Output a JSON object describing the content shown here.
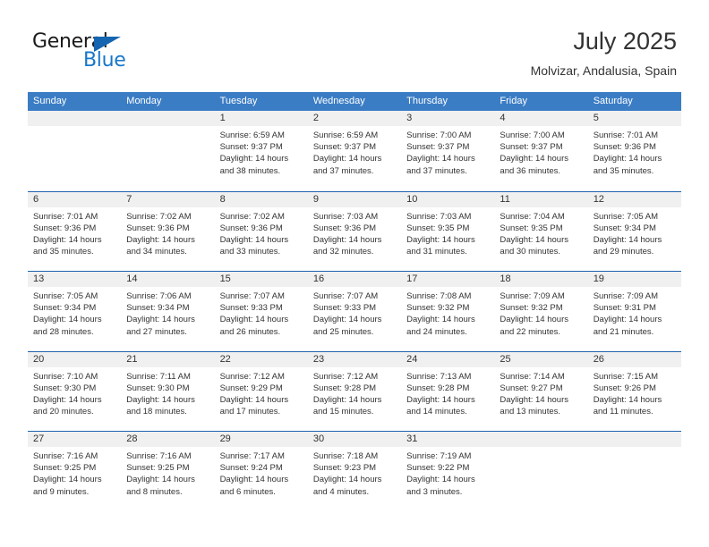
{
  "brand": {
    "name_part1": "General",
    "name_part2": "Blue",
    "triangle_icon": "triangle-icon",
    "primary_color": "#1877c9",
    "triangle_color": "#1565b0"
  },
  "header": {
    "title": "July 2025",
    "subtitle": "Molvizar, Andalusia, Spain"
  },
  "calendar": {
    "header_bg": "#3b7dc4",
    "row_divider_color": "#1f63ad",
    "day_band_bg": "#f0f0f0",
    "weekdays": [
      "Sunday",
      "Monday",
      "Tuesday",
      "Wednesday",
      "Thursday",
      "Friday",
      "Saturday"
    ],
    "weeks": [
      [
        {
          "day": "",
          "sunrise": "",
          "sunset": "",
          "daylight_line1": "",
          "daylight_line2": ""
        },
        {
          "day": "",
          "sunrise": "",
          "sunset": "",
          "daylight_line1": "",
          "daylight_line2": ""
        },
        {
          "day": "1",
          "sunrise": "Sunrise: 6:59 AM",
          "sunset": "Sunset: 9:37 PM",
          "daylight_line1": "Daylight: 14 hours",
          "daylight_line2": "and 38 minutes."
        },
        {
          "day": "2",
          "sunrise": "Sunrise: 6:59 AM",
          "sunset": "Sunset: 9:37 PM",
          "daylight_line1": "Daylight: 14 hours",
          "daylight_line2": "and 37 minutes."
        },
        {
          "day": "3",
          "sunrise": "Sunrise: 7:00 AM",
          "sunset": "Sunset: 9:37 PM",
          "daylight_line1": "Daylight: 14 hours",
          "daylight_line2": "and 37 minutes."
        },
        {
          "day": "4",
          "sunrise": "Sunrise: 7:00 AM",
          "sunset": "Sunset: 9:37 PM",
          "daylight_line1": "Daylight: 14 hours",
          "daylight_line2": "and 36 minutes."
        },
        {
          "day": "5",
          "sunrise": "Sunrise: 7:01 AM",
          "sunset": "Sunset: 9:36 PM",
          "daylight_line1": "Daylight: 14 hours",
          "daylight_line2": "and 35 minutes."
        }
      ],
      [
        {
          "day": "6",
          "sunrise": "Sunrise: 7:01 AM",
          "sunset": "Sunset: 9:36 PM",
          "daylight_line1": "Daylight: 14 hours",
          "daylight_line2": "and 35 minutes."
        },
        {
          "day": "7",
          "sunrise": "Sunrise: 7:02 AM",
          "sunset": "Sunset: 9:36 PM",
          "daylight_line1": "Daylight: 14 hours",
          "daylight_line2": "and 34 minutes."
        },
        {
          "day": "8",
          "sunrise": "Sunrise: 7:02 AM",
          "sunset": "Sunset: 9:36 PM",
          "daylight_line1": "Daylight: 14 hours",
          "daylight_line2": "and 33 minutes."
        },
        {
          "day": "9",
          "sunrise": "Sunrise: 7:03 AM",
          "sunset": "Sunset: 9:36 PM",
          "daylight_line1": "Daylight: 14 hours",
          "daylight_line2": "and 32 minutes."
        },
        {
          "day": "10",
          "sunrise": "Sunrise: 7:03 AM",
          "sunset": "Sunset: 9:35 PM",
          "daylight_line1": "Daylight: 14 hours",
          "daylight_line2": "and 31 minutes."
        },
        {
          "day": "11",
          "sunrise": "Sunrise: 7:04 AM",
          "sunset": "Sunset: 9:35 PM",
          "daylight_line1": "Daylight: 14 hours",
          "daylight_line2": "and 30 minutes."
        },
        {
          "day": "12",
          "sunrise": "Sunrise: 7:05 AM",
          "sunset": "Sunset: 9:34 PM",
          "daylight_line1": "Daylight: 14 hours",
          "daylight_line2": "and 29 minutes."
        }
      ],
      [
        {
          "day": "13",
          "sunrise": "Sunrise: 7:05 AM",
          "sunset": "Sunset: 9:34 PM",
          "daylight_line1": "Daylight: 14 hours",
          "daylight_line2": "and 28 minutes."
        },
        {
          "day": "14",
          "sunrise": "Sunrise: 7:06 AM",
          "sunset": "Sunset: 9:34 PM",
          "daylight_line1": "Daylight: 14 hours",
          "daylight_line2": "and 27 minutes."
        },
        {
          "day": "15",
          "sunrise": "Sunrise: 7:07 AM",
          "sunset": "Sunset: 9:33 PM",
          "daylight_line1": "Daylight: 14 hours",
          "daylight_line2": "and 26 minutes."
        },
        {
          "day": "16",
          "sunrise": "Sunrise: 7:07 AM",
          "sunset": "Sunset: 9:33 PM",
          "daylight_line1": "Daylight: 14 hours",
          "daylight_line2": "and 25 minutes."
        },
        {
          "day": "17",
          "sunrise": "Sunrise: 7:08 AM",
          "sunset": "Sunset: 9:32 PM",
          "daylight_line1": "Daylight: 14 hours",
          "daylight_line2": "and 24 minutes."
        },
        {
          "day": "18",
          "sunrise": "Sunrise: 7:09 AM",
          "sunset": "Sunset: 9:32 PM",
          "daylight_line1": "Daylight: 14 hours",
          "daylight_line2": "and 22 minutes."
        },
        {
          "day": "19",
          "sunrise": "Sunrise: 7:09 AM",
          "sunset": "Sunset: 9:31 PM",
          "daylight_line1": "Daylight: 14 hours",
          "daylight_line2": "and 21 minutes."
        }
      ],
      [
        {
          "day": "20",
          "sunrise": "Sunrise: 7:10 AM",
          "sunset": "Sunset: 9:30 PM",
          "daylight_line1": "Daylight: 14 hours",
          "daylight_line2": "and 20 minutes."
        },
        {
          "day": "21",
          "sunrise": "Sunrise: 7:11 AM",
          "sunset": "Sunset: 9:30 PM",
          "daylight_line1": "Daylight: 14 hours",
          "daylight_line2": "and 18 minutes."
        },
        {
          "day": "22",
          "sunrise": "Sunrise: 7:12 AM",
          "sunset": "Sunset: 9:29 PM",
          "daylight_line1": "Daylight: 14 hours",
          "daylight_line2": "and 17 minutes."
        },
        {
          "day": "23",
          "sunrise": "Sunrise: 7:12 AM",
          "sunset": "Sunset: 9:28 PM",
          "daylight_line1": "Daylight: 14 hours",
          "daylight_line2": "and 15 minutes."
        },
        {
          "day": "24",
          "sunrise": "Sunrise: 7:13 AM",
          "sunset": "Sunset: 9:28 PM",
          "daylight_line1": "Daylight: 14 hours",
          "daylight_line2": "and 14 minutes."
        },
        {
          "day": "25",
          "sunrise": "Sunrise: 7:14 AM",
          "sunset": "Sunset: 9:27 PM",
          "daylight_line1": "Daylight: 14 hours",
          "daylight_line2": "and 13 minutes."
        },
        {
          "day": "26",
          "sunrise": "Sunrise: 7:15 AM",
          "sunset": "Sunset: 9:26 PM",
          "daylight_line1": "Daylight: 14 hours",
          "daylight_line2": "and 11 minutes."
        }
      ],
      [
        {
          "day": "27",
          "sunrise": "Sunrise: 7:16 AM",
          "sunset": "Sunset: 9:25 PM",
          "daylight_line1": "Daylight: 14 hours",
          "daylight_line2": "and 9 minutes."
        },
        {
          "day": "28",
          "sunrise": "Sunrise: 7:16 AM",
          "sunset": "Sunset: 9:25 PM",
          "daylight_line1": "Daylight: 14 hours",
          "daylight_line2": "and 8 minutes."
        },
        {
          "day": "29",
          "sunrise": "Sunrise: 7:17 AM",
          "sunset": "Sunset: 9:24 PM",
          "daylight_line1": "Daylight: 14 hours",
          "daylight_line2": "and 6 minutes."
        },
        {
          "day": "30",
          "sunrise": "Sunrise: 7:18 AM",
          "sunset": "Sunset: 9:23 PM",
          "daylight_line1": "Daylight: 14 hours",
          "daylight_line2": "and 4 minutes."
        },
        {
          "day": "31",
          "sunrise": "Sunrise: 7:19 AM",
          "sunset": "Sunset: 9:22 PM",
          "daylight_line1": "Daylight: 14 hours",
          "daylight_line2": "and 3 minutes."
        },
        {
          "day": "",
          "sunrise": "",
          "sunset": "",
          "daylight_line1": "",
          "daylight_line2": ""
        },
        {
          "day": "",
          "sunrise": "",
          "sunset": "",
          "daylight_line1": "",
          "daylight_line2": ""
        }
      ]
    ]
  }
}
